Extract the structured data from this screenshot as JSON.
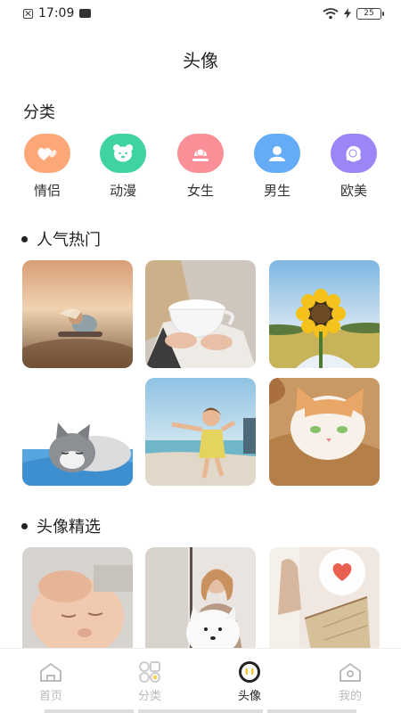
{
  "status": {
    "time": "17:09",
    "battery": "25"
  },
  "title": "头像",
  "category": {
    "label": "分类",
    "items": [
      {
        "label": "情侣",
        "color": "#fca777",
        "icon": "hearts-icon"
      },
      {
        "label": "动漫",
        "color": "#3fd3a0",
        "icon": "bear-icon"
      },
      {
        "label": "女生",
        "color": "#fa8f97",
        "icon": "girl-icon"
      },
      {
        "label": "男生",
        "color": "#64adf6",
        "icon": "boy-icon"
      },
      {
        "label": "欧美",
        "color": "#9c86f7",
        "icon": "western-icon"
      }
    ]
  },
  "popular": {
    "title": "人气热门"
  },
  "featured": {
    "title": "头像精选"
  },
  "tabs": [
    {
      "label": "首页",
      "icon": "home-icon",
      "active": false
    },
    {
      "label": "分类",
      "icon": "category-icon",
      "active": false
    },
    {
      "label": "头像",
      "icon": "avatar-icon",
      "active": true
    },
    {
      "label": "我的",
      "icon": "profile-icon",
      "active": false
    }
  ]
}
